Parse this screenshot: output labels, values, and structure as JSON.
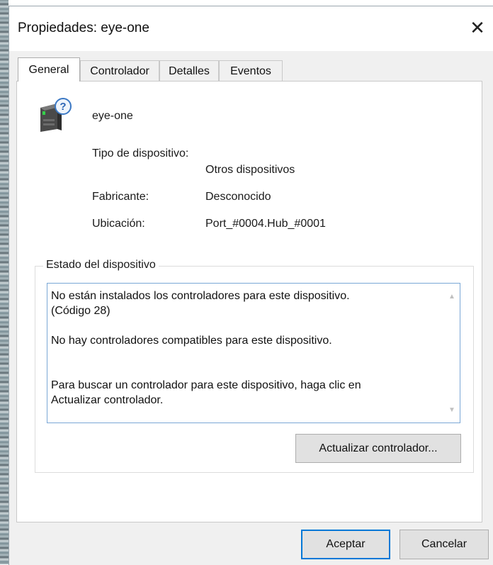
{
  "window": {
    "title": "Propiedades: eye-one",
    "close_glyph": "✕"
  },
  "tabs": [
    {
      "label": "General",
      "active": true
    },
    {
      "label": "Controlador",
      "active": false
    },
    {
      "label": "Detalles",
      "active": false
    },
    {
      "label": "Eventos",
      "active": false
    }
  ],
  "device": {
    "icon": "unknown-device-icon",
    "name": "eye-one",
    "type_label": "Tipo de dispositivo:",
    "type_value": "Otros dispositivos",
    "manufacturer_label": "Fabricante:",
    "manufacturer_value": "Desconocido",
    "location_label": "Ubicación:",
    "location_value": "Port_#0004.Hub_#0001"
  },
  "status": {
    "group_label": "Estado del dispositivo",
    "line1": "No están instalados los controladores para este dispositivo.",
    "line2": "(Código 28)",
    "line3": "No hay controladores compatibles para este dispositivo.",
    "line4": "Para buscar un controlador para este dispositivo, haga clic en",
    "line5": "Actualizar controlador.",
    "update_button": "Actualizar controlador..."
  },
  "footer": {
    "ok_label": "Aceptar",
    "cancel_label": "Cancelar"
  },
  "colors": {
    "accent": "#0078d7",
    "status_border": "#7aa7d6",
    "dialog_bg": "#f0f0f0"
  }
}
